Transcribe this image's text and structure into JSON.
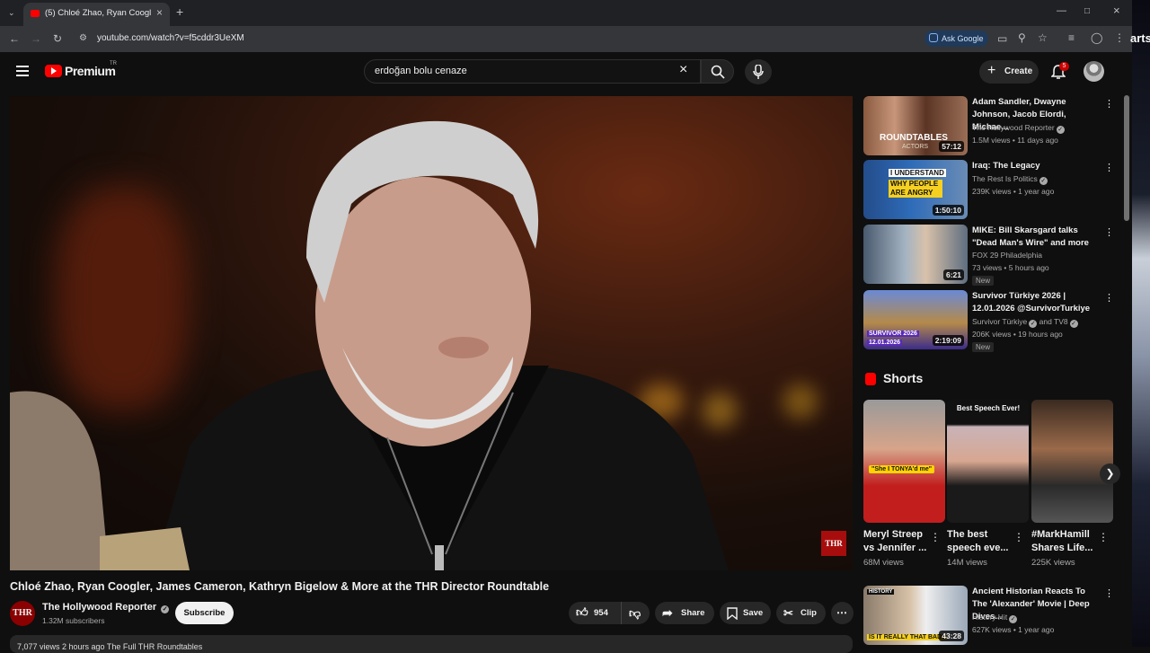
{
  "browser": {
    "tab_title": "(5) Chloé Zhao, Ryan Coogler, J",
    "url": "youtube.com/watch?v=f5cddr3UeXM",
    "ask_google": "Ask Google",
    "desktop_text": "arts"
  },
  "header": {
    "logo_text": "Premium",
    "logo_tr": "TR",
    "search_value": "erdoğan bolu cenaze",
    "create_label": "Create",
    "notification_count": "5"
  },
  "player": {
    "watermark": "THR"
  },
  "video": {
    "title": "Chloé Zhao, Ryan Coogler, James Cameron, Kathryn Bigelow & More at the THR Director Roundtable",
    "channel_logo": "THR",
    "channel_name": "The Hollywood Reporter",
    "subscribers": "1.32M subscribers",
    "subscribe_label": "Subscribe",
    "likes": "954",
    "share_label": "Share",
    "save_label": "Save",
    "clip_label": "Clip",
    "description_peek": "7,077 views  2 hours ago  The Full THR Roundtables"
  },
  "recommendations": [
    {
      "title": "Adam Sandler, Dwayne Johnson, Jacob Elordi, Michae...",
      "channel": "The Hollywood Reporter",
      "channel2": "",
      "views": "1.5M views • 11 days ago",
      "duration": "57:12",
      "badge": "",
      "thumb_text": "ROUNDTABLES",
      "thumb_sub": "ACTORS",
      "thumb_color": "#7a4a36"
    },
    {
      "title": "Iraq: The Legacy",
      "channel": "The Rest Is Politics",
      "channel2": "",
      "views": "239K views • 1 year ago",
      "duration": "1:50:10",
      "badge": "",
      "thumb_text": "I UNDERSTAND",
      "thumb_sub": "WHY PEOPLE ARE ANGRY",
      "thumb_color": "#1d3f8a"
    },
    {
      "title": "MIKE: Bill Skarsgard talks \"Dead Man's Wire\" and more",
      "channel": "FOX 29 Philadelphia",
      "channel2": "",
      "views": "73 views • 5 hours ago",
      "duration": "6:21",
      "badge": "New",
      "thumb_text": "",
      "thumb_sub": "",
      "thumb_color": "#5c6e83"
    },
    {
      "title": "Survivor Türkiye 2026 | 12.01.2026 @SurvivorTurkiye",
      "channel": "Survivor Türkiye",
      "channel2": "and TV8",
      "views": "206K views • 19 hours ago",
      "duration": "2:19:09",
      "badge": "New",
      "thumb_text": "SURVIVOR 2026",
      "thumb_sub": "12.01.2026",
      "thumb_color": "#3a4fae"
    }
  ],
  "shorts": {
    "heading": "Shorts",
    "items": [
      {
        "title": "Meryl Streep vs Jennifer ...",
        "views": "68M views",
        "caption": "\"She I TONYA'd me\"",
        "color": "#b21a1a"
      },
      {
        "title": "The best speech eve...",
        "views": "14M views",
        "caption": "Best Speech Ever!",
        "color": "#2a2a2a"
      },
      {
        "title": "#MarkHamill Shares Life...",
        "views": "225K views",
        "caption": "",
        "color": "#6a4a38"
      }
    ]
  },
  "bottom_rec": {
    "title": "Ancient Historian Reacts To The 'Alexander' Movie | Deep Dives...",
    "channel": "History Hit",
    "views": "627K views • 1 year ago",
    "duration": "43:28",
    "thumb_label": "HISTORY",
    "thumb_text": "IS IT REALLY THAT BAD?"
  }
}
